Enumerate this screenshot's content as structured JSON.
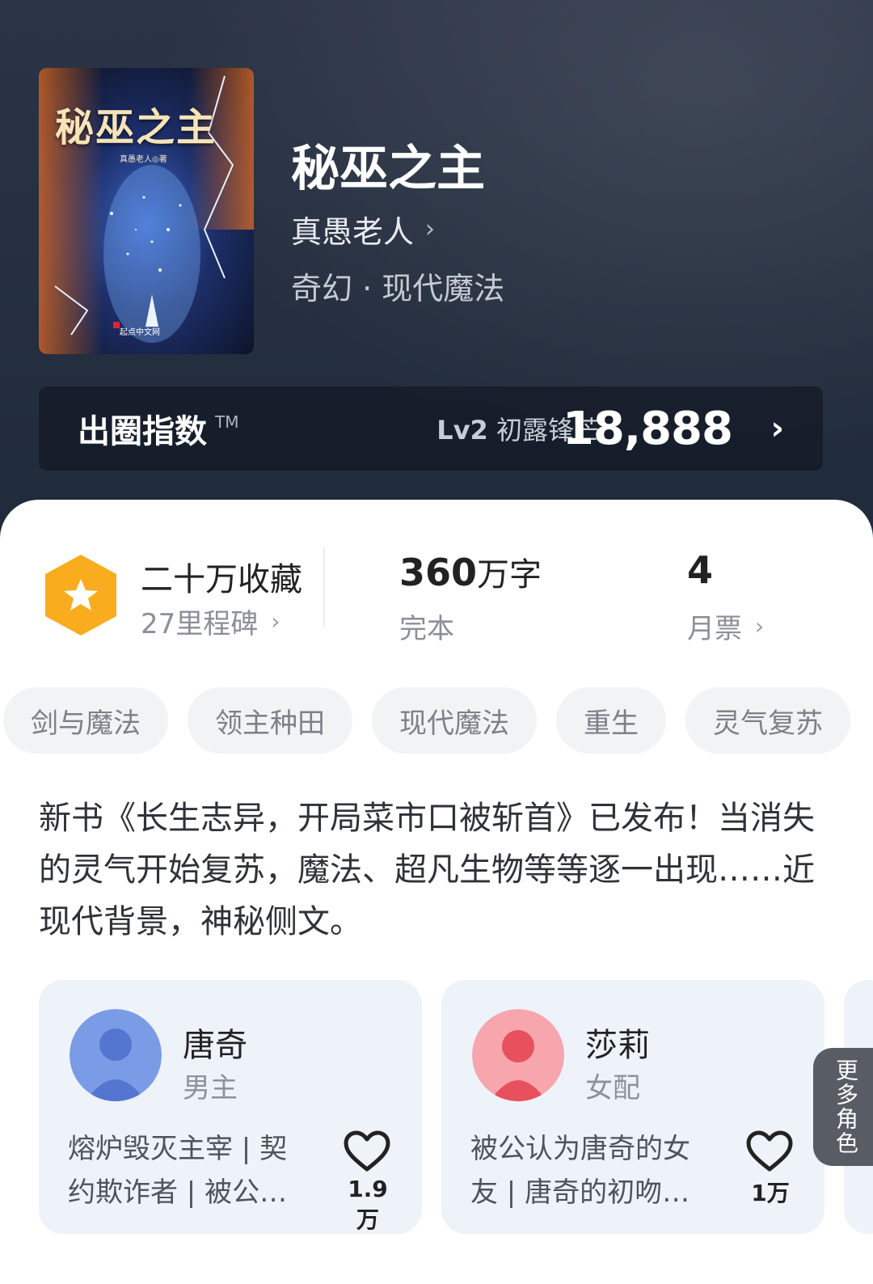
{
  "book": {
    "cover_title": "秘巫之主",
    "cover_author": "真愚老人◎著",
    "cover_brand": "起点中文网",
    "title": "秘巫之主",
    "author": "真愚老人",
    "genre": "奇幻 · 现代魔法"
  },
  "index_bar": {
    "label": "出圈指数",
    "tm": "TM",
    "level": "Lv2",
    "level_name": "初露锋芒",
    "value": "18,888"
  },
  "stats": {
    "collect_title": "二十万收藏",
    "milestone": "27里程碑",
    "words_num": "360",
    "words_unit": "万字",
    "status": "完本",
    "monthly_votes": "4",
    "monthly_label": "月票"
  },
  "tags": [
    "剑与魔法",
    "领主种田",
    "现代魔法",
    "重生",
    "灵气复苏"
  ],
  "description": "新书《长生志异，开局菜市口被斩首》已发布！当消失的灵气开始复苏，魔法、超凡生物等等逐一出现……近现代背景，神秘侧文。",
  "characters": [
    {
      "name": "唐奇",
      "role": "男主",
      "desc": "熔炉毁灭主宰 | 契约欺诈者 | 被公…",
      "likes": "1.9万",
      "color": "#7a9be6"
    },
    {
      "name": "莎莉",
      "role": "女配",
      "desc": "被公认为唐奇的女友 | 唐奇的初吻…",
      "likes": "1万",
      "color": "#f07a86"
    }
  ],
  "more_roles": "更多角色",
  "colors": {
    "badge": "#f9ad1e",
    "hero_bg": "#263040"
  }
}
